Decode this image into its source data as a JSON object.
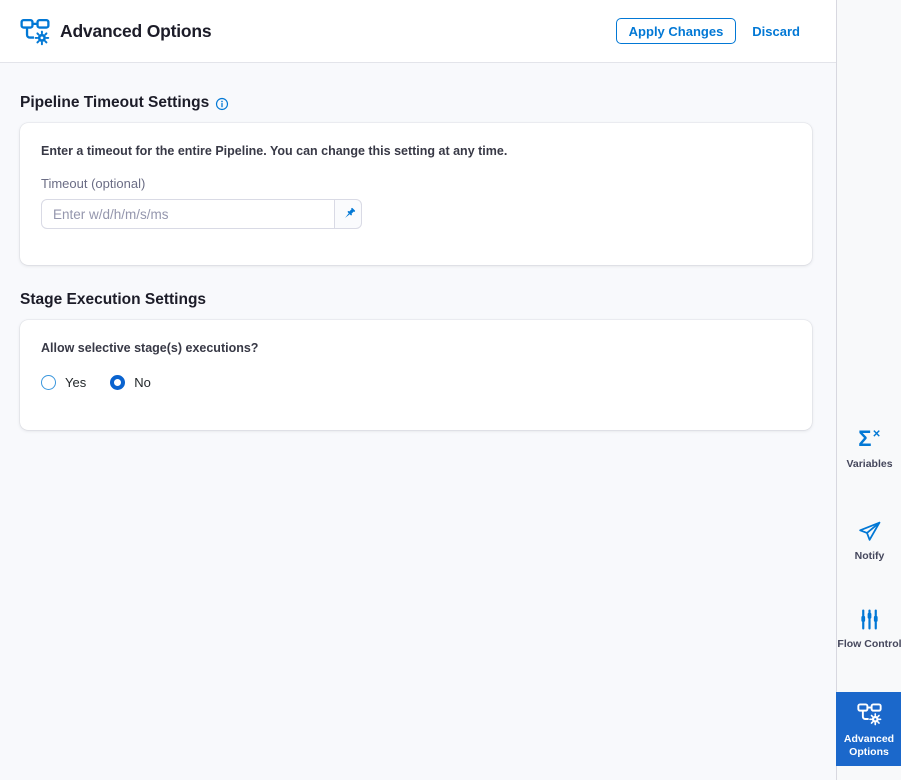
{
  "header": {
    "title": "Advanced Options",
    "apply_label": "Apply Changes",
    "discard_label": "Discard",
    "icon": "pipeline-gear-icon"
  },
  "sections": {
    "timeout": {
      "heading": "Pipeline Timeout Settings",
      "info_icon": "info-icon",
      "description": "Enter a timeout for the entire Pipeline. You can change this setting at any time.",
      "field_label": "Timeout (optional)",
      "value": "",
      "placeholder": "Enter w/d/h/m/s/ms",
      "pin_icon": "pushpin-icon"
    },
    "stage_execution": {
      "heading": "Stage Execution Settings",
      "question": "Allow selective stage(s) executions?",
      "options": [
        {
          "label": "Yes",
          "selected": false
        },
        {
          "label": "No",
          "selected": true
        }
      ]
    }
  },
  "sidebar": {
    "items": [
      {
        "label": "Variables",
        "icon": "sigma-x-icon",
        "active": false
      },
      {
        "label": "Notify",
        "icon": "paper-plane-icon",
        "active": false
      },
      {
        "label": "Flow Control",
        "icon": "sliders-icon",
        "active": false
      },
      {
        "label": "Advanced Options",
        "icon": "pipeline-gear-icon",
        "active": true
      }
    ]
  },
  "colors": {
    "primary": "#0278d5",
    "active_nav_bg": "#1b68cb",
    "content_bg": "#f8f9fc",
    "sidebar_bg": "#f8f9fa"
  }
}
